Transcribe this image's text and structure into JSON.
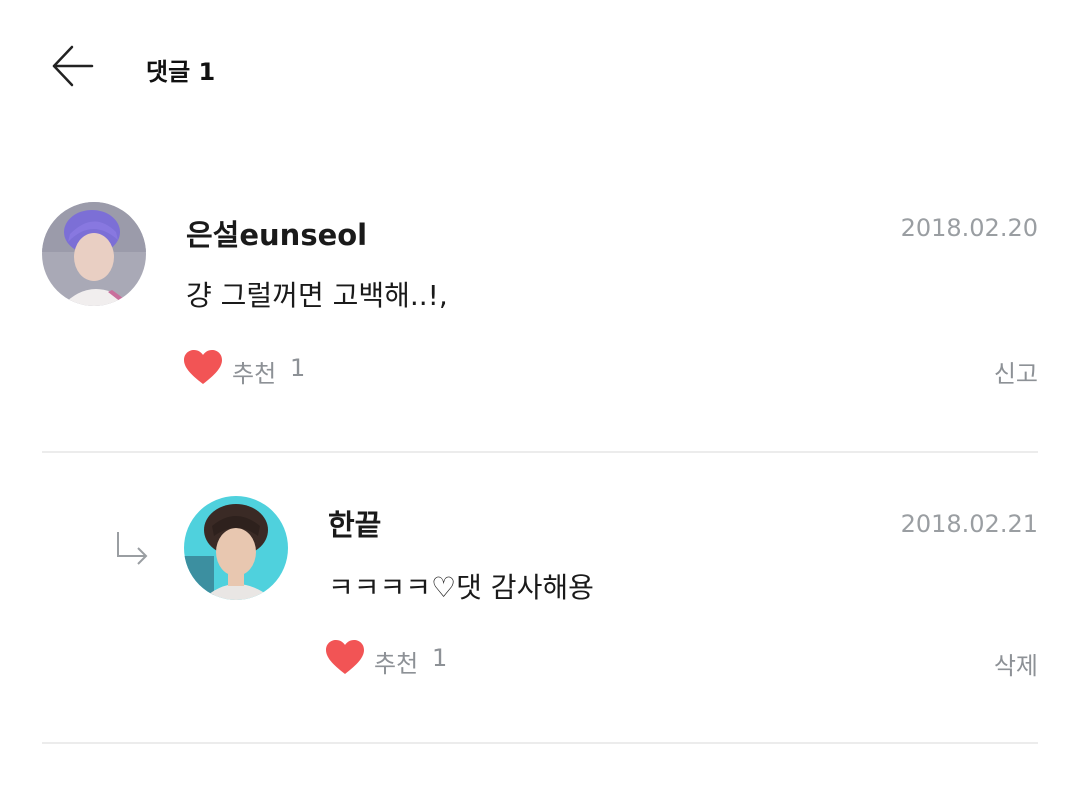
{
  "header": {
    "title": "댓글 1",
    "back_icon": "arrow-left-icon"
  },
  "comments": [
    {
      "author": "은설eunseol",
      "date": "2018.02.20",
      "text": "걍 그럴꺼면 고백해..!,",
      "like_label": "추천",
      "like_count": "1",
      "action": "신고",
      "is_reply": false,
      "avatar_colors": [
        "#7c6fd6",
        "#b7b7c9"
      ]
    },
    {
      "author": "한끝",
      "date": "2018.02.21",
      "text": "ㅋㅋㅋㅋ♡댓 감사해용",
      "like_label": "추천",
      "like_count": "1",
      "action": "삭제",
      "is_reply": true,
      "avatar_colors": [
        "#3a2a25",
        "#4fd1dd"
      ]
    }
  ],
  "colors": {
    "heart": "#f25455",
    "muted_text": "#8d9196",
    "date_text": "#9a9ea2",
    "divider": "#ececec"
  }
}
